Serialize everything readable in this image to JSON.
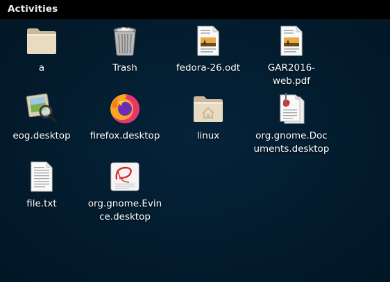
{
  "topbar": {
    "activities_label": "Activities"
  },
  "desktop": {
    "items": [
      {
        "label_lines": [
          "a"
        ],
        "icon": "folder-icon"
      },
      {
        "label_lines": [
          "Trash"
        ],
        "icon": "trash-icon"
      },
      {
        "label_lines": [
          "fedora-26.odt"
        ],
        "icon": "odt-document-icon"
      },
      {
        "label_lines": [
          "GAR2016-",
          "web.pdf"
        ],
        "icon": "pdf-document-icon"
      },
      {
        "label_lines": [
          "eog.desktop"
        ],
        "icon": "image-viewer-icon"
      },
      {
        "label_lines": [
          "firefox.desktop"
        ],
        "icon": "firefox-icon"
      },
      {
        "label_lines": [
          "linux"
        ],
        "icon": "home-folder-icon"
      },
      {
        "label_lines": [
          "org.gnome.Doc",
          "uments.desktop"
        ],
        "icon": "documents-app-icon"
      },
      {
        "label_lines": [
          "file.txt"
        ],
        "icon": "text-file-icon"
      },
      {
        "label_lines": [
          "org.gnome.Evin",
          "ce.desktop"
        ],
        "icon": "evince-icon"
      }
    ]
  },
  "colors": {
    "topbar": "#000000",
    "desktop_background": "#031c2e",
    "label_text": "#ffffff",
    "folder": "#e8d8bd"
  }
}
